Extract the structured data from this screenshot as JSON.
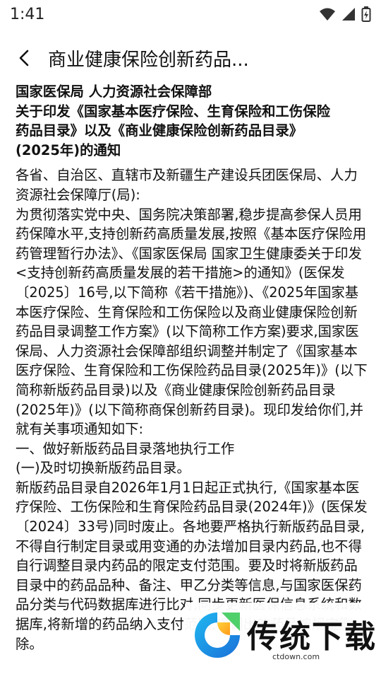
{
  "status": {
    "time": "1:41"
  },
  "nav": {
    "title": "商业健康保险创新药品...",
    "back_icon": "chevron-left-icon"
  },
  "document": {
    "heading": [
      "国家医保局 人力资源社会保障部",
      "关于印发《国家基本医疗保险、生育保险和工伤保险",
      "药品目录》以及《商业健康保险创新药品目录》",
      "(2025年)的通知"
    ],
    "paragraphs": [
      "各省、自治区、直辖市及新疆生产建设兵团医保局、人力资源社会保障厅(局):",
      "为贯彻落实党中央、国务院决策部署,稳步提高参保人员用药保障水平,支持创新药高质量发展,按照《基本医疗保险用药管理暂行办法》、《国家医保局 国家卫生健康委关于印发<支持创新药高质量发展的若干措施>的通知》(医保发〔2025〕16号,以下简称《若干措施》)、《2025年国家基本医疗保险、生育保险和工伤保险以及商业健康保险创新药品目录调整工作方案》(以下简称工作方案)要求,国家医保局、人力资源社会保障部组织调整并制定了《国家基本医疗保险、生育保险和工伤保险药品目录(2025年)》(以下简称新版药品目录)以及《商业健康保险创新药品目录(2025年)》(以下简称商保创新药目录)。现印发给你们,并就有关事项通知如下:",
      "一、做好新版药品目录落地执行工作",
      "(一)及时切换新版药品目录。",
      "新版药品目录自2026年1月1日起正式执行,《国家基本医疗保险、工伤保险和生育保险药品目录(2024年)》(医保发〔2024〕33号)同时废止。各地要严格执行新版药品目录,不得自行制定目录或用变通的办法增加目录内药品,也不得自行调整目录内药品的限定支付范围。要及时将新版药品目录中的药品品种、备注、甲乙分类等信息,与国家医保药品分类与代码数据库进行比对,同步更新医保信息系统和数据库,将新增的药品纳入支付范围,将调出的药品按规定删除。"
    ]
  },
  "watermark": {
    "brand": "传统下载",
    "url": "ctdown.com"
  }
}
